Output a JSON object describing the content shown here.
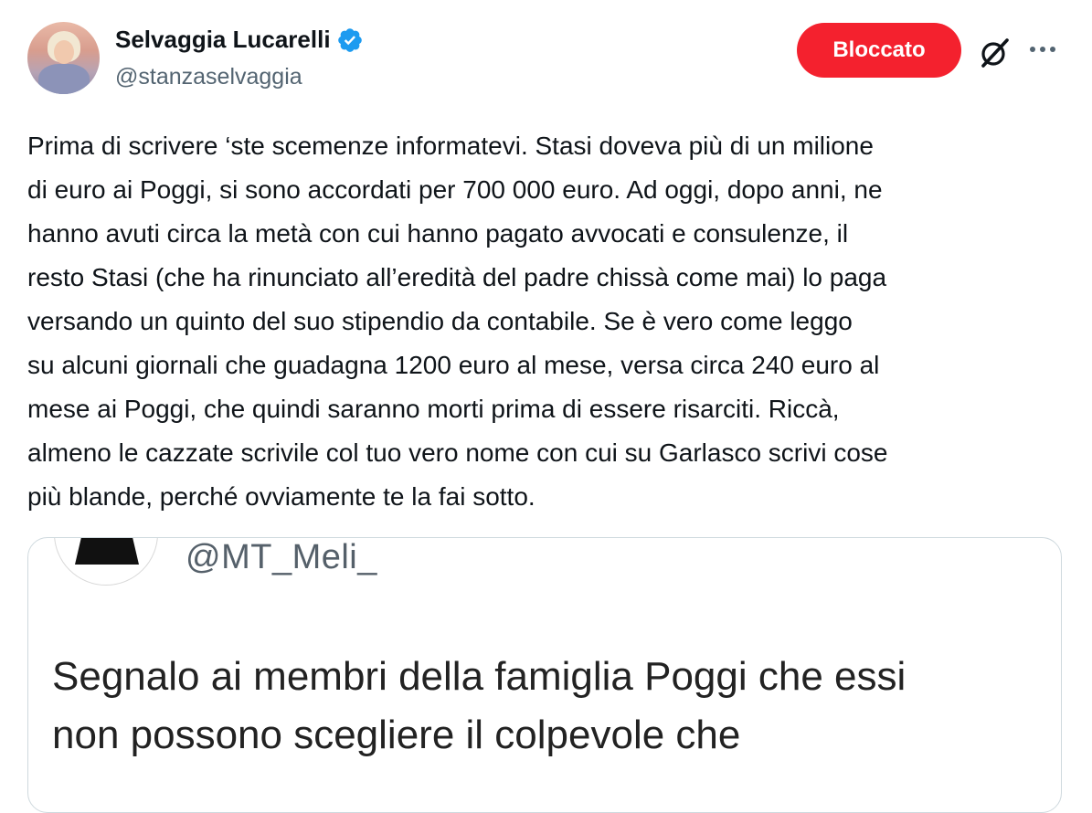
{
  "author": {
    "display_name": "Selvaggia Lucarelli",
    "handle": "@stanzaselvaggia",
    "avatar_icon": "user-photo",
    "verified_icon": "verified-badge-icon",
    "verified_color": "#1d9bf0"
  },
  "actions": {
    "blocked_label": "Bloccato",
    "blocked_color": "#f4212e",
    "grok_icon": "grok-icon",
    "more_icon": "more-icon"
  },
  "tweet": {
    "text": "Prima di scrivere ‘ste scemenze informatevi. Stasi doveva più di un milione\ndi euro ai Poggi, si sono accordati per 700 000 euro. Ad oggi, dopo anni, ne\nhanno avuti circa la metà con cui hanno pagato avvocati e consulenze, il\nresto Stasi (che ha rinunciato all’eredità del padre chissà come mai) lo paga\nversando un quinto del suo stipendio da contabile. Se è vero come leggo\nsu alcuni giornali che guadagna 1200 euro al mese, versa circa 240 euro al\nmese ai Poggi, che quindi saranno morti prima di essere risarciti. Riccà,\nalmeno le cazzate scrivile col tuo vero nome con cui su Garlasco scrivi cose\npiù blande, perché ovviamente te la fai sotto."
  },
  "quoted": {
    "handle": "@MT_Meli_",
    "text": "Segnalo ai membri della famiglia Poggi che essi\nnon possono scegliere il colpevole che"
  }
}
